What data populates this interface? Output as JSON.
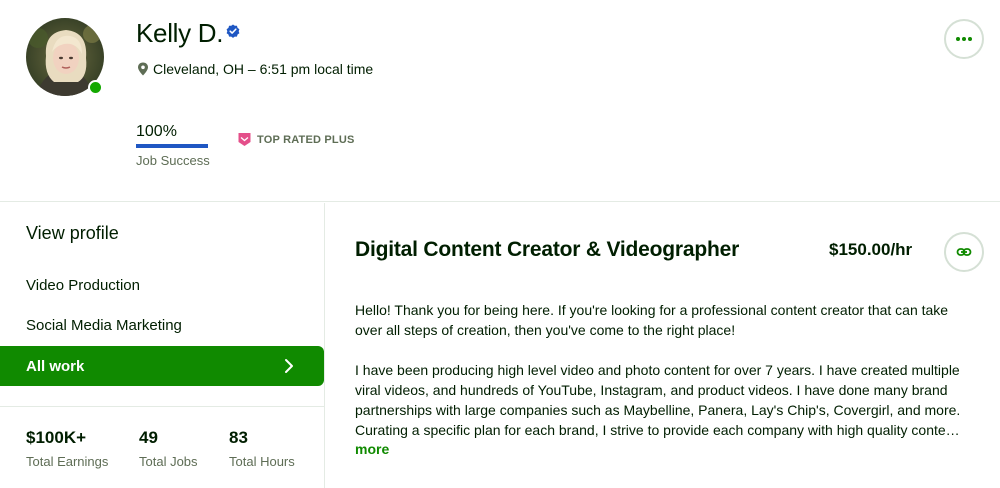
{
  "profile": {
    "name": "Kelly D.",
    "location": "Cleveland, OH – 6:51 pm local time",
    "job_success_value": "100%",
    "job_success_label": "Job Success",
    "job_success_fraction": 1.0,
    "badge_label": "TOP RATED PLUS",
    "online": true
  },
  "icons": {
    "verified": "verified-badge-icon",
    "location": "map-pin-icon",
    "more": "more-horizontal-icon",
    "badge": "top-rated-plus-icon",
    "chevron": "chevron-right-icon",
    "link": "link-icon"
  },
  "sidebar": {
    "view_profile": "View profile",
    "items": [
      {
        "label": "Video Production"
      },
      {
        "label": "Social Media Marketing"
      },
      {
        "label": "All work",
        "selected": true
      }
    ],
    "stats": [
      {
        "value": "$100K+",
        "label": "Total Earnings"
      },
      {
        "value": "49",
        "label": "Total Jobs"
      },
      {
        "value": "83",
        "label": "Total Hours"
      }
    ]
  },
  "main": {
    "title": "Digital Content Creator & Videographer",
    "rate": "$150.00/hr",
    "description_lines_1": [
      "Hello! Thank you for being here. If you're looking for a professional content creator that can take",
      "over all steps of creation, then you've come to the right place!"
    ],
    "description_lines_2": [
      "I have been producing high level video and photo content for over 7 years. I have created multiple",
      "viral videos, and hundreds of YouTube, Instagram, and product videos. I have done many brand",
      "partnerships with large companies such as Maybelline, Panera, Lay's Chip's, Covergirl, and more.",
      "Curating a specific plan for each brand, I strive to provide each company with high quality conte…"
    ],
    "more_label": "more"
  },
  "colors": {
    "brand_green": "#108a00",
    "online_green": "#14a800",
    "jss_blue": "#1f57c3",
    "verified_blue": "#1f57c3",
    "badge_pink": "#e44f8a",
    "text_dark": "#001e00",
    "text_muted": "#5e6d55"
  }
}
